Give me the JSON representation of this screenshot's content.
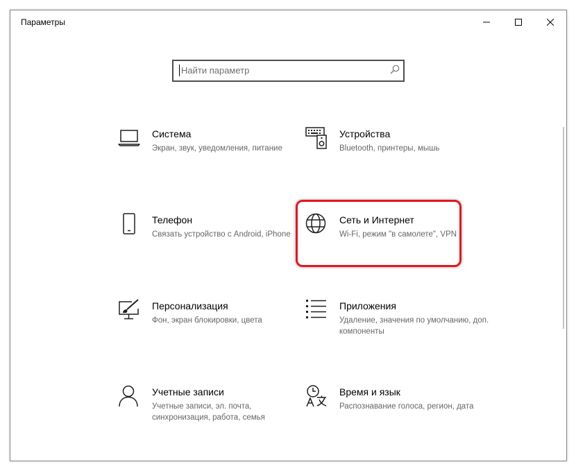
{
  "window": {
    "title": "Параметры"
  },
  "search": {
    "placeholder": "Найти параметр"
  },
  "tiles": [
    {
      "name": "Система",
      "desc": "Экран, звук, уведомления, питание",
      "icon": "laptop-icon"
    },
    {
      "name": "Устройства",
      "desc": "Bluetooth, принтеры, мышь",
      "icon": "devices-icon"
    },
    {
      "name": "Телефон",
      "desc": "Связать устройство с Android, iPhone",
      "icon": "phone-icon"
    },
    {
      "name": "Сеть и Интернет",
      "desc": "Wi-Fi, режим \"в самолете\", VPN",
      "icon": "globe-icon"
    },
    {
      "name": "Персонализация",
      "desc": "Фон, экран блокировки, цвета",
      "icon": "personalization-icon"
    },
    {
      "name": "Приложения",
      "desc": "Удаление, значения по умолчанию, доп. компоненты",
      "icon": "apps-list-icon"
    },
    {
      "name": "Учетные записи",
      "desc": "Учетные записи, эл. почта, синхронизация, работа, семья",
      "icon": "person-icon"
    },
    {
      "name": "Время и язык",
      "desc": "Распознавание голоса, регион, дата",
      "icon": "time-language-icon"
    }
  ],
  "highlighted_tile": "Сеть и Интернет",
  "colors": {
    "highlight": "#e8141b",
    "text_secondary": "#666666"
  }
}
